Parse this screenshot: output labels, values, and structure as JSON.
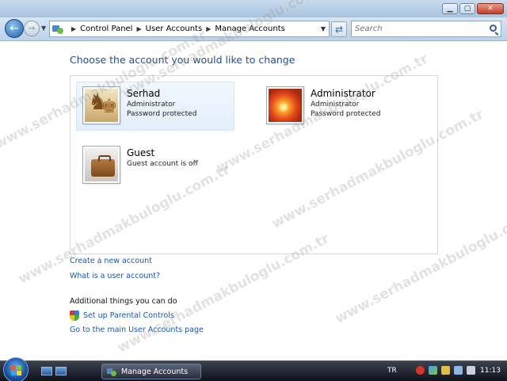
{
  "nav": {
    "breadcrumb": [
      "Control Panel",
      "User Accounts",
      "Manage Accounts"
    ],
    "search_placeholder": "Search"
  },
  "main": {
    "heading": "Choose the account you would like to change",
    "accounts": [
      {
        "name": "Serhad",
        "lines": [
          "Administrator",
          "Password protected"
        ],
        "picture": "chess-pieces-picture",
        "selected": true
      },
      {
        "name": "Administrator",
        "lines": [
          "Administrator",
          "Password protected"
        ],
        "picture": "orange-flower-picture"
      },
      {
        "name": "Guest",
        "lines": [
          "Guest account is off"
        ],
        "picture": "suitcase-picture"
      }
    ],
    "links": [
      "Create a new account",
      "What is a user account?"
    ],
    "additional_heading": "Additional things you can do",
    "parental_controls": "Set up Parental Controls",
    "main_page_link": "Go to the main User Accounts page"
  },
  "watermark": "www.serhadmakbuloglu.com.tr",
  "taskbar": {
    "task_label": "Manage Accounts",
    "language": "TR",
    "clock": "11:13"
  },
  "colors": {
    "link": "#1a56b8",
    "heading": "#1e4f95"
  }
}
